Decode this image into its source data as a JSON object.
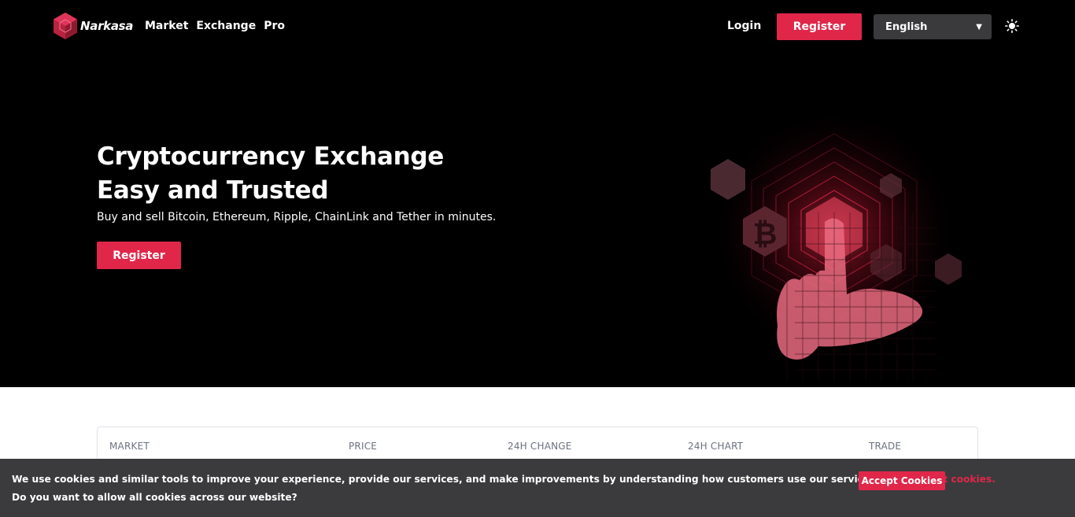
{
  "brand": {
    "name": "Narkasa",
    "accent_color": "#e0274a"
  },
  "nav": {
    "links": [
      "Market",
      "Exchange",
      "Pro"
    ],
    "login_label": "Login",
    "register_label": "Register",
    "language": "English",
    "theme_icon": "sun-icon"
  },
  "hero": {
    "title_line1": "Cryptocurrency Exchange",
    "title_line2": "Easy and Trusted",
    "subtitle": "Buy and sell Bitcoin, Ethereum, Ripple, ChainLink and Tether in minutes.",
    "register_label": "Register"
  },
  "market_table": {
    "columns": [
      "MARKET",
      "PRICE",
      "24H CHANGE",
      "24H CHART",
      "TRADE"
    ]
  },
  "cookie_banner": {
    "message": "We use cookies and similar tools to improve your experience, provide our services, and make improvements by understanding how customers use our services.",
    "link_text": "Learn about cookies.",
    "question": "Do you want to allow all cookies across our website?",
    "accept_label": "Accept Cookies"
  }
}
